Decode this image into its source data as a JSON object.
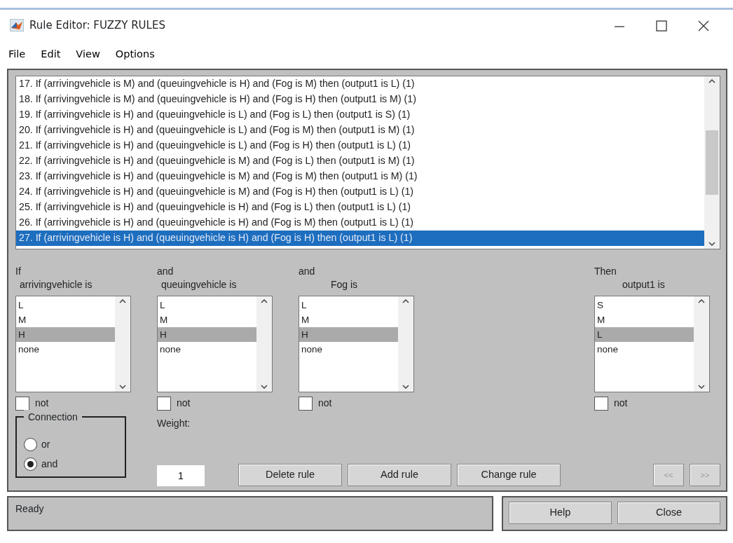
{
  "window": {
    "title": "Rule Editor: FUZZY RULES"
  },
  "menu": [
    "File",
    "Edit",
    "View",
    "Options"
  ],
  "rules": [
    {
      "text": "17. If (arrivingvehicle is M) and (queuingvehicle is H) and (Fog is M) then (output1 is L) (1)",
      "selected": false
    },
    {
      "text": "18. If (arrivingvehicle is M) and (queuingvehicle is H) and (Fog is H) then (output1 is M) (1)",
      "selected": false
    },
    {
      "text": "19. If (arrivingvehicle is H) and (queuingvehicle is L) and (Fog is L) then (output1 is S) (1)",
      "selected": false
    },
    {
      "text": "20. If (arrivingvehicle is H) and (queuingvehicle is L) and (Fog is M) then (output1 is M) (1)",
      "selected": false
    },
    {
      "text": "21. If (arrivingvehicle is H) and (queuingvehicle is L) and (Fog is H) then (output1 is L) (1)",
      "selected": false
    },
    {
      "text": "22. If (arrivingvehicle is H) and (queuingvehicle is M) and (Fog is L) then (output1 is M) (1)",
      "selected": false
    },
    {
      "text": "23. If (arrivingvehicle is H) and (queuingvehicle is M) and (Fog is M) then (output1 is M) (1)",
      "selected": false
    },
    {
      "text": "24. If (arrivingvehicle is H) and (queuingvehicle is M) and (Fog is H) then (output1 is L) (1)",
      "selected": false
    },
    {
      "text": "25. If (arrivingvehicle is H) and (queuingvehicle is H) and (Fog is L) then (output1 is L) (1)",
      "selected": false
    },
    {
      "text": "26. If (arrivingvehicle is H) and (queuingvehicle is H) and (Fog is M) then (output1 is L) (1)",
      "selected": false
    },
    {
      "text": "27. If (arrivingvehicle is H) and (queuingvehicle is H) and (Fog is H) then (output1 is L) (1)",
      "selected": true
    }
  ],
  "variables": [
    {
      "connector": "If",
      "label": "arrivingvehicle is",
      "options": [
        {
          "text": "L",
          "selected": false
        },
        {
          "text": "M",
          "selected": false
        },
        {
          "text": "H",
          "selected": true
        },
        {
          "text": "none",
          "selected": false
        }
      ],
      "not": {
        "label": "not",
        "checked": false
      }
    },
    {
      "connector": "and",
      "label": "queuingvehicle is",
      "options": [
        {
          "text": "L",
          "selected": false
        },
        {
          "text": "M",
          "selected": false
        },
        {
          "text": "H",
          "selected": true
        },
        {
          "text": "none",
          "selected": false
        }
      ],
      "not": {
        "label": "not",
        "checked": false
      }
    },
    {
      "connector": "and",
      "label": "Fog is",
      "options": [
        {
          "text": "L",
          "selected": false
        },
        {
          "text": "M",
          "selected": false
        },
        {
          "text": "H",
          "selected": true
        },
        {
          "text": "none",
          "selected": false
        }
      ],
      "not": {
        "label": "not",
        "checked": false
      }
    },
    {
      "connector": "Then",
      "label": "output1 is",
      "options": [
        {
          "text": "S",
          "selected": false
        },
        {
          "text": "M",
          "selected": false
        },
        {
          "text": "L",
          "selected": true
        },
        {
          "text": "none",
          "selected": false
        }
      ],
      "not": {
        "label": "not",
        "checked": false
      }
    }
  ],
  "connection": {
    "title": "Connection",
    "options": [
      {
        "label": "or",
        "selected": false
      },
      {
        "label": "and",
        "selected": true
      }
    ]
  },
  "weight": {
    "label": "Weight:",
    "value": "1"
  },
  "actions": [
    {
      "label": "Delete rule",
      "disabled": false
    },
    {
      "label": "Add rule",
      "disabled": false
    },
    {
      "label": "Change rule",
      "disabled": false
    }
  ],
  "nav": [
    {
      "label": "<<",
      "disabled": true
    },
    {
      "label": ">>",
      "disabled": true
    }
  ],
  "status": "Ready",
  "footer_buttons": [
    "Help",
    "Close"
  ]
}
